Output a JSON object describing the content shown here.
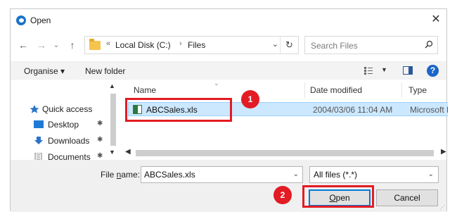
{
  "window": {
    "title": "Open",
    "close_glyph": "✕"
  },
  "nav": {
    "back_glyph": "←",
    "forward_glyph": "→",
    "recent_glyph": "⌄",
    "up_glyph": "↑",
    "address": {
      "overflow": "«",
      "parts": [
        "Local Disk (C:)",
        "Files"
      ],
      "separator": "›",
      "dropdown_glyph": "⌄",
      "refresh_glyph": "↻"
    },
    "search_placeholder": "Search Files"
  },
  "toolbar": {
    "organise_label": "Organise ▾",
    "new_folder_label": "New folder",
    "view_dropdown_glyph": "▼",
    "help_glyph": "?"
  },
  "sidebar": {
    "items": [
      {
        "label": "Quick access",
        "icon": "star-icon"
      },
      {
        "label": "Desktop",
        "icon": "desktop-icon",
        "pin": "✱"
      },
      {
        "label": "Downloads",
        "icon": "download-icon",
        "pin": "✱"
      },
      {
        "label": "Documents",
        "icon": "documents-icon",
        "pin": "✱"
      }
    ]
  },
  "file_list": {
    "columns": [
      "Name",
      "Date modified",
      "Type"
    ],
    "rows": [
      {
        "name": "ABCSales.xls",
        "date": "2004/03/06 11:04 AM",
        "type": "Microsoft E",
        "selected": true,
        "icon": "excel-file-icon"
      }
    ]
  },
  "bottom": {
    "file_name_label_pre": "File ",
    "file_name_label_u": "n",
    "file_name_label_post": "ame:",
    "file_name_value": "ABCSales.xls",
    "file_type_value": "All files (*.*)",
    "open_label_u": "O",
    "open_label_rest": "pen",
    "cancel_label": "Cancel"
  },
  "annotations": {
    "step1": "1",
    "step2": "2",
    "highlight_color": "#e31b23"
  },
  "colors": {
    "selection": "#cce8ff",
    "accent": "#0078d7"
  }
}
